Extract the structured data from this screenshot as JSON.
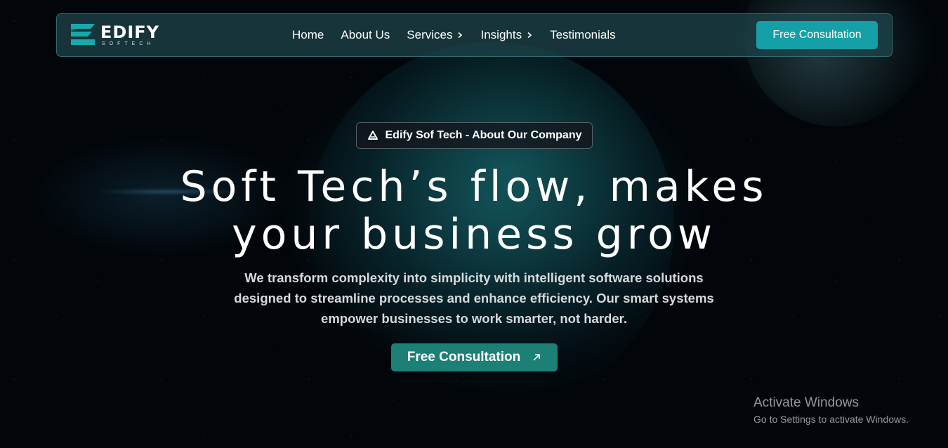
{
  "brand": {
    "name": "EDIFY",
    "tagline": "SOFTECH",
    "logo_icon": "edify-logo-icon"
  },
  "nav": {
    "items": [
      {
        "label": "Home",
        "has_chevron": false
      },
      {
        "label": "About Us",
        "has_chevron": false
      },
      {
        "label": "Services",
        "has_chevron": true
      },
      {
        "label": "Insights",
        "has_chevron": true
      },
      {
        "label": "Testimonials",
        "has_chevron": false
      }
    ],
    "cta_label": "Free Consultation"
  },
  "hero": {
    "badge_icon": "edify-badge-icon",
    "badge_text": "Edify Sof Tech - About Our Company",
    "headline_line1": "Soft Tech’s flow, makes",
    "headline_line2": "your business grow",
    "subtext": "We transform complexity into simplicity with intelligent software solutions designed to streamline processes and enhance efficiency. Our smart systems empower businesses to work smarter, not harder.",
    "cta_label": "Free Consultation",
    "cta_icon": "arrow-up-right-icon"
  },
  "watermark": {
    "title": "Activate Windows",
    "subtitle": "Go to Settings to activate Windows."
  },
  "colors": {
    "accent": "#14a0a6",
    "hero_button": "#1c8077",
    "nav_bg": "#1e464e"
  }
}
